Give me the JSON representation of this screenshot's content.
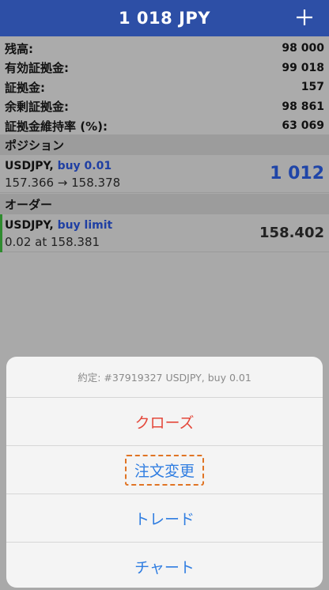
{
  "header": {
    "title": "1 018 JPY",
    "add_icon": "plus-icon"
  },
  "summary": [
    {
      "label": "残高:",
      "value": "98 000"
    },
    {
      "label": "有効証拠金:",
      "value": "99 018"
    },
    {
      "label": "証拠金:",
      "value": "157"
    },
    {
      "label": "余剰証拠金:",
      "value": "98 861"
    },
    {
      "label": "証拠金維持率 (%):",
      "value": "63 069"
    }
  ],
  "positions": {
    "section_title": "ポジション",
    "item": {
      "symbol": "USDJPY,",
      "side": "buy 0.01",
      "prices": "157.366 → 158.378",
      "profit": "1 012"
    }
  },
  "orders": {
    "section_title": "オーダー",
    "item": {
      "symbol": "USDJPY,",
      "side": "buy limit",
      "detail": "0.02 at 158.381",
      "price": "158.402"
    }
  },
  "action_sheet": {
    "caption": "約定: #37919327 USDJPY, buy 0.01",
    "close_label": "クローズ",
    "modify_label": "注文変更",
    "trade_label": "トレード",
    "chart_label": "チャート"
  },
  "colors": {
    "header_bg": "#2d4fa6",
    "profit": "#1f45a8",
    "destructive": "#e4473a",
    "action": "#2f7de1",
    "highlight": "#e07424",
    "order_accent": "#2e8b2e"
  }
}
